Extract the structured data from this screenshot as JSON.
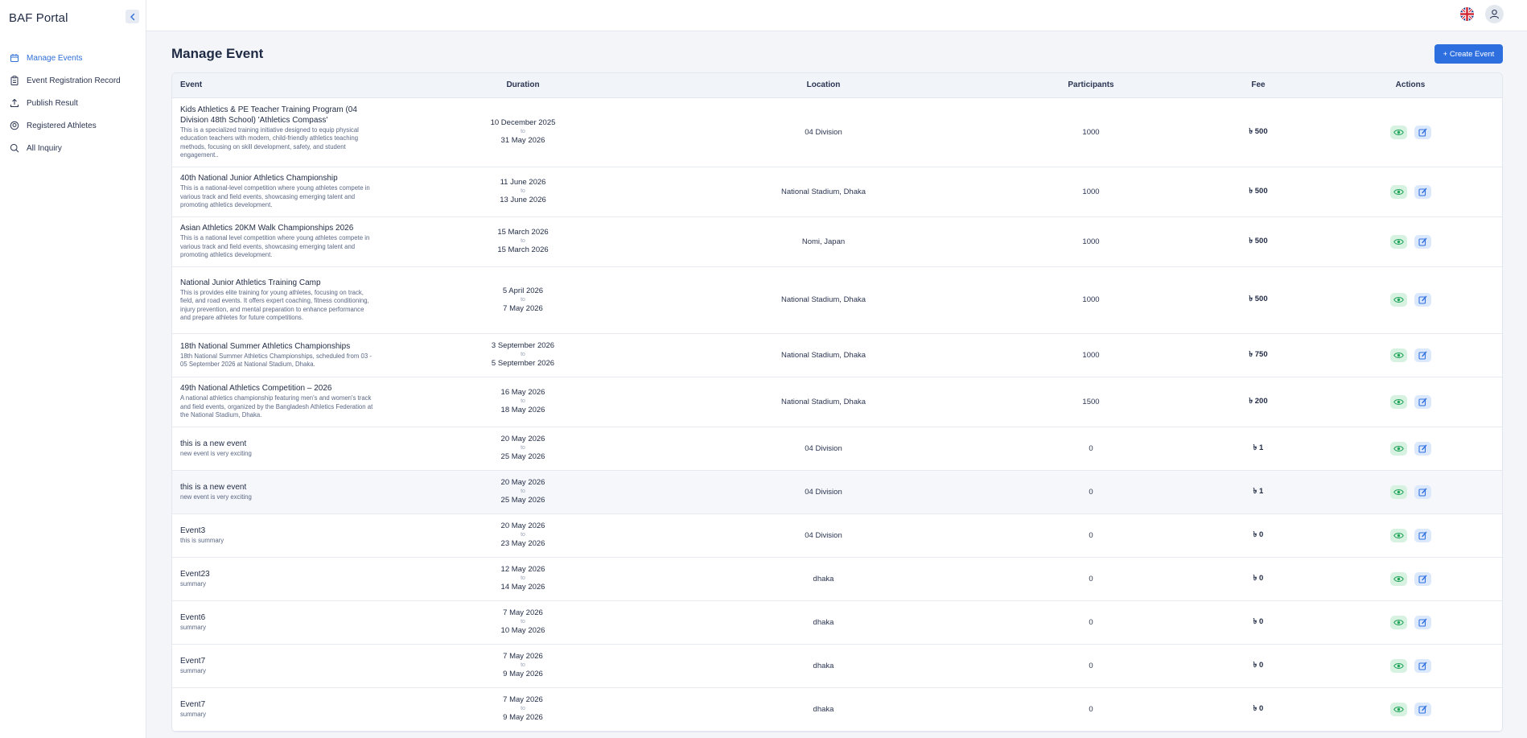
{
  "app": {
    "title": "BAF Portal"
  },
  "sidebar": {
    "items": [
      {
        "label": "Manage Events",
        "icon": "calendar-icon",
        "active": true
      },
      {
        "label": "Event Registration Record",
        "icon": "clipboard-icon",
        "active": false
      },
      {
        "label": "Publish Result",
        "icon": "upload-icon",
        "active": false
      },
      {
        "label": "Registered Athletes",
        "icon": "badge-icon",
        "active": false
      },
      {
        "label": "All Inquiry",
        "icon": "search-icon",
        "active": false
      }
    ]
  },
  "page": {
    "title": "Manage Event",
    "create_label": "+ Create Event"
  },
  "table": {
    "headers": {
      "event": "Event",
      "duration": "Duration",
      "location": "Location",
      "participants": "Participants",
      "fee": "Fee",
      "actions": "Actions"
    },
    "to_label": "to",
    "rows": [
      {
        "title": "Kids Athletics & PE Teacher Training Program (04 Division 48th School) 'Athletics Compass'",
        "summary": "This is a specialized training initiative designed to equip physical education teachers with modern, child-friendly athletics teaching methods, focusing on skill development, safety, and student engagement..",
        "start": "10 December 2025",
        "end": "31 May 2026",
        "location": "04 Division",
        "participants": "1000",
        "fee": "৳ 500"
      },
      {
        "title": "40th National Junior Athletics Championship",
        "summary": "This is a national-level competition where young athletes compete in various track and field events, showcasing emerging talent and promoting athletics development.",
        "start": "11 June 2026",
        "end": "13 June 2026",
        "location": "National Stadium, Dhaka",
        "participants": "1000",
        "fee": "৳ 500"
      },
      {
        "title": "Asian Athletics 20KM Walk Championships 2026",
        "summary": "This is a national level competition where young athletes compete in various track and field events, showcasing emerging talent and promoting athletics development.",
        "start": "15 March 2026",
        "end": "15 March 2026",
        "location": "Nomi, Japan",
        "participants": "1000",
        "fee": "৳ 500"
      },
      {
        "title": "National Junior Athletics Training Camp",
        "summary": "This is provides elite training for young athletes, focusing on track, field, and road events. It offers expert coaching, fitness conditioning, injury prevention, and mental preparation to enhance performance and prepare athletes for future competitions.",
        "start": "5 April 2026",
        "end": "7 May 2026",
        "location": "National Stadium, Dhaka",
        "participants": "1000",
        "fee": "৳ 500"
      },
      {
        "title": "18th National Summer Athletics Championships",
        "summary": "18th National Summer Athletics Championships, scheduled from 03 - 05 September 2026 at National Stadium, Dhaka.",
        "start": "3 September 2026",
        "end": "5 September 2026",
        "location": "National Stadium, Dhaka",
        "participants": "1000",
        "fee": "৳ 750"
      },
      {
        "title": "49th National Athletics Competition – 2026",
        "summary": "A national athletics championship featuring men's and women's track and field events, organized by the Bangladesh Athletics Federation at the National Stadium, Dhaka.",
        "start": "16 May 2026",
        "end": "18 May 2026",
        "location": "National Stadium, Dhaka",
        "participants": "1500",
        "fee": "৳ 200"
      },
      {
        "title": "this is a new event",
        "summary": "new event is very exciting",
        "start": "20 May 2026",
        "end": "25 May 2026",
        "location": "04 Division",
        "participants": "0",
        "fee": "৳ 1"
      },
      {
        "title": "this is a new event",
        "summary": "new event is very exciting",
        "start": "20 May 2026",
        "end": "25 May 2026",
        "location": "04 Division",
        "participants": "0",
        "fee": "৳ 1"
      },
      {
        "title": "Event3",
        "summary": "this is summary",
        "start": "20 May 2026",
        "end": "23 May 2026",
        "location": "04 Division",
        "participants": "0",
        "fee": "৳ 0"
      },
      {
        "title": "Event23",
        "summary": "summary",
        "start": "12 May 2026",
        "end": "14 May 2026",
        "location": "dhaka",
        "participants": "0",
        "fee": "৳ 0"
      },
      {
        "title": "Event6",
        "summary": "summary",
        "start": "7 May 2026",
        "end": "10 May 2026",
        "location": "dhaka",
        "participants": "0",
        "fee": "৳ 0"
      },
      {
        "title": "Event7",
        "summary": "summary",
        "start": "7 May 2026",
        "end": "9 May 2026",
        "location": "dhaka",
        "participants": "0",
        "fee": "৳ 0"
      },
      {
        "title": "Event7",
        "summary": "summary",
        "start": "7 May 2026",
        "end": "9 May 2026",
        "location": "dhaka",
        "participants": "0",
        "fee": "৳ 0"
      }
    ]
  },
  "colors": {
    "accent": "#2e6fe0",
    "view_bg": "#d8f2e2",
    "view_icon": "#22a55a",
    "edit_bg": "#dce8fb",
    "edit_icon": "#2e6fe0"
  }
}
